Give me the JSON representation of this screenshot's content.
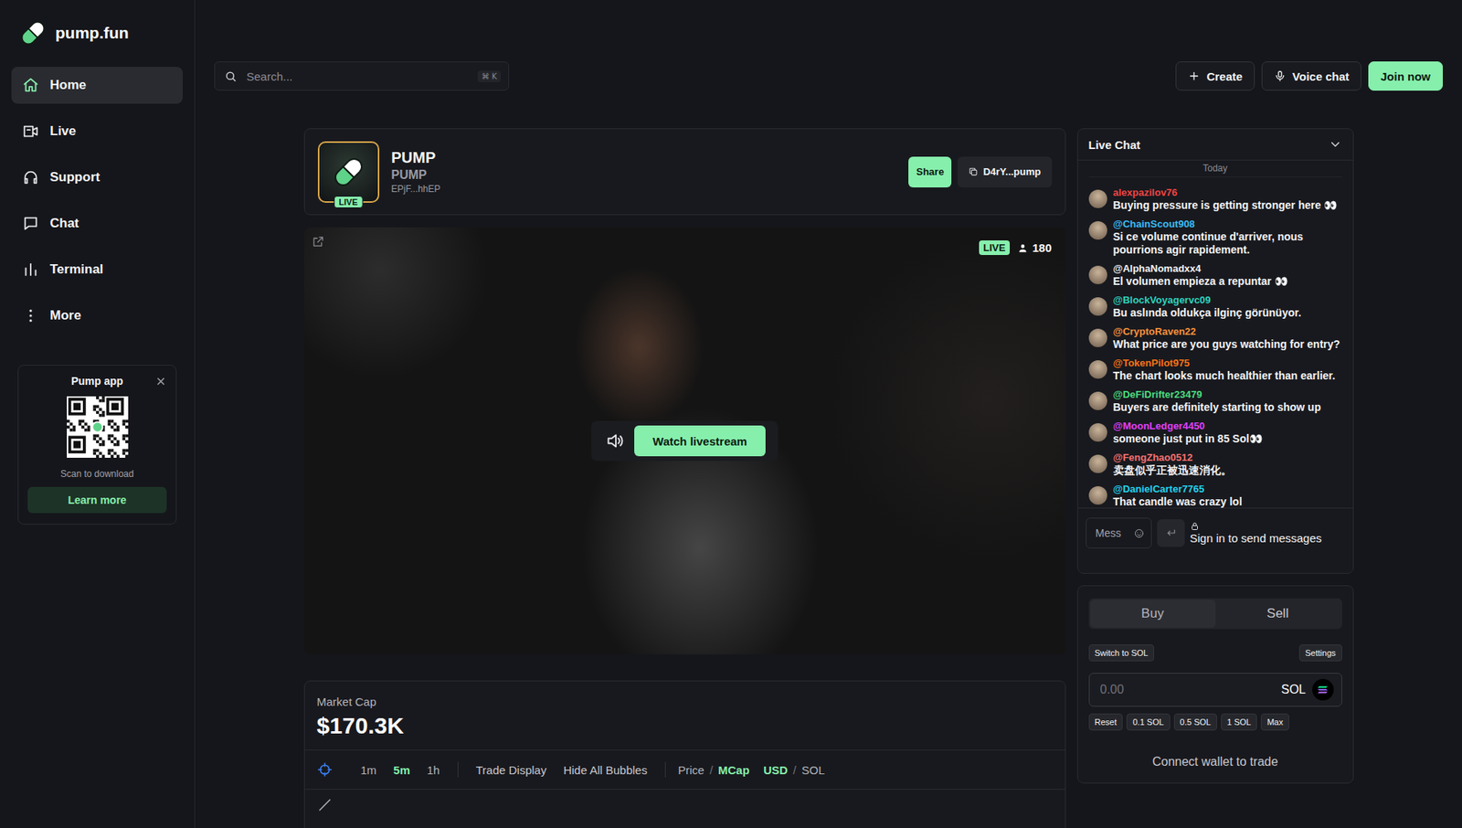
{
  "logo": {
    "text": "pump.fun"
  },
  "sidebar": {
    "items": [
      {
        "label": "Home",
        "selected": true
      },
      {
        "label": "Live",
        "selected": false
      },
      {
        "label": "Support",
        "selected": false
      },
      {
        "label": "Chat",
        "selected": false
      },
      {
        "label": "Terminal",
        "selected": false
      },
      {
        "label": "More",
        "selected": false
      }
    ]
  },
  "promo": {
    "title": "Pump app",
    "caption": "Scan to download",
    "button": "Learn more"
  },
  "search": {
    "placeholder": "Search...",
    "shortcut": "⌘ K"
  },
  "top_buttons": [
    {
      "label": "Create",
      "kind": "create"
    },
    {
      "label": "Voice chat",
      "kind": "voice"
    },
    {
      "label": "Join now",
      "kind": "primary"
    }
  ],
  "token": {
    "name": "PUMP",
    "symbol": "PUMP",
    "address": "EPjF...hhEP",
    "live_badge": "LIVE",
    "share": "Share",
    "contract": "D4rY...pump"
  },
  "stream": {
    "live_badge": "LIVE",
    "viewers": "180",
    "button": "Watch livestream"
  },
  "market": {
    "label": "Market Cap",
    "value": "$170.3K",
    "intervals": [
      {
        "label": "1m",
        "selected": false
      },
      {
        "label": "5m",
        "selected": true
      },
      {
        "label": "1h",
        "selected": false
      }
    ],
    "toggles": [
      "Trade Display",
      "Hide All Bubbles"
    ],
    "separator": "/",
    "units": [
      {
        "label": "Price",
        "selected": false
      },
      {
        "label": "MCap",
        "selected": true
      }
    ],
    "currencies": [
      {
        "label": "USD",
        "selected": true
      },
      {
        "label": "SOL",
        "selected": false
      }
    ]
  },
  "chat": {
    "title": "Live Chat",
    "day": "Today",
    "messages": [
      {
        "user": "alexpazilov76",
        "text": "Buying pressure is getting stronger here 👀",
        "color": "#ef4444"
      },
      {
        "user": "@ChainScout908",
        "text": "Si ce volume continue d'arriver, nous pourrions agir rapidement.",
        "color": "#38bdf8"
      },
      {
        "user": "@AlphaNomadxx4",
        "text": "El volumen empieza a repuntar 👀",
        "color": "#f4f4f5"
      },
      {
        "user": "@BlockVoyagervc09",
        "text": "Bu aslında oldukça ilginç görünüyor.",
        "color": "#2dd4bf"
      },
      {
        "user": "@CryptoRaven22",
        "text": "What price are you guys watching for entry?",
        "color": "#fb923c"
      },
      {
        "user": "@TokenPilot975",
        "text": "The chart looks much healthier than earlier.",
        "color": "#f97316"
      },
      {
        "user": "@DeFiDrifter23479",
        "text": "Buyers are definitely starting to show up",
        "color": "#4ade80"
      },
      {
        "user": "@MoonLedger4450",
        "text": "someone just put in 85 Sol👀",
        "color": "#e040fb"
      },
      {
        "user": "@FengZhao0512",
        "text": "卖盘似乎正被迅速消化。",
        "color": "#f87171"
      },
      {
        "user": "@DanielCarter7765",
        "text": "That candle was crazy lol",
        "color": "#22d3ee"
      }
    ],
    "input_placeholder": "Mess",
    "sign_in": "Sign in to send messages"
  },
  "trade": {
    "tabs": [
      {
        "label": "Buy",
        "selected": true
      },
      {
        "label": "Sell",
        "selected": false
      }
    ],
    "switch": "Switch to SOL",
    "settings": "Settings",
    "amount_placeholder": "0.00",
    "currency": "SOL",
    "quick": [
      "Reset",
      "0.1 SOL",
      "0.5 SOL",
      "1 SOL",
      "Max"
    ],
    "connect": "Connect wallet to trade"
  }
}
